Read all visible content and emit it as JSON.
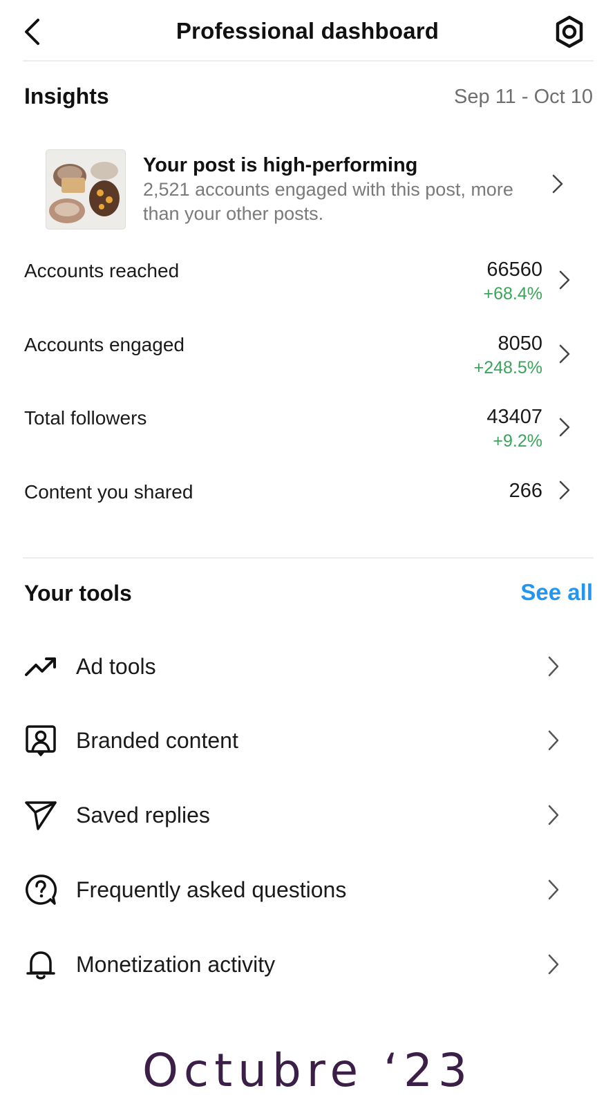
{
  "header": {
    "title": "Professional dashboard",
    "back_icon": "chevron-left-icon",
    "settings_icon": "gear-icon"
  },
  "insights": {
    "title": "Insights",
    "date_range": "Sep 11 - Oct 10",
    "highlight": {
      "title": "Your post is high-performing",
      "description": "2,521 accounts engaged with this post, more than your other posts."
    },
    "metrics": [
      {
        "label": "Accounts reached",
        "value": "66560",
        "change": "+68.4%"
      },
      {
        "label": "Accounts engaged",
        "value": "8050",
        "change": "+248.5%"
      },
      {
        "label": "Total followers",
        "value": "43407",
        "change": "+9.2%"
      },
      {
        "label": "Content you shared",
        "value": "266",
        "change": ""
      }
    ]
  },
  "tools": {
    "title": "Your tools",
    "see_all": "See all",
    "items": [
      {
        "label": "Ad tools",
        "icon": "trending-up-icon"
      },
      {
        "label": "Branded content",
        "icon": "branded-content-icon"
      },
      {
        "label": "Saved replies",
        "icon": "paper-plane-icon"
      },
      {
        "label": "Frequently asked questions",
        "icon": "question-bubble-icon"
      },
      {
        "label": "Monetization activity",
        "icon": "bell-icon"
      }
    ]
  },
  "caption": "Octubre ‘23",
  "colors": {
    "positive_change": "#3aa55a",
    "link": "#2196f3",
    "caption": "#3b1f47",
    "muted_text": "#7a7a7a"
  }
}
